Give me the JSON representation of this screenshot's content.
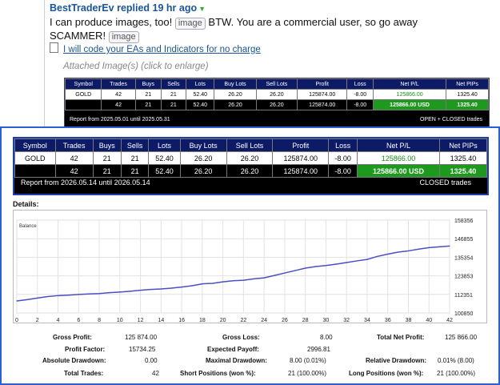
{
  "post": {
    "author": "BestTraderEv",
    "action": " replied ",
    "time": "19 hr ago",
    "line_start": "I can produce images, too!",
    "image_tag": "image",
    "line_end": "BTW. You are a commercial user, so go away",
    "line2": "SCAMMER!",
    "signature": "I will code your EAs and Indicators for no charge",
    "attached": "Attached Image(s) (click to enlarge)"
  },
  "small_report": {
    "headers": [
      "Symbol",
      "Trades",
      "Buys",
      "Sells",
      "Lots",
      "Buy Lots",
      "Sell Lots",
      "Profit",
      "Loss",
      "Net P/L",
      "Net PIPs"
    ],
    "row1": [
      "GOLD",
      "42",
      "21",
      "21",
      "52.40",
      "26.20",
      "26.20",
      "125874.00",
      "-8.00",
      "125866.00",
      "1325.40"
    ],
    "row2": [
      "",
      "42",
      "21",
      "21",
      "52.40",
      "26.20",
      "26.20",
      "125874.00",
      "-8.00",
      "125866.00 USD",
      "1325.40"
    ],
    "footer_left": "Report from 2025.05.01 until 2025.05.31",
    "footer_right": "OPEN + CLOSED trades"
  },
  "big_report": {
    "headers": [
      "Symbol",
      "Trades",
      "Buys",
      "Sells",
      "Lots",
      "Buy Lots",
      "Sell Lots",
      "Profit",
      "Loss",
      "Net P/L",
      "Net PIPs"
    ],
    "row1": [
      "GOLD",
      "42",
      "21",
      "21",
      "52.40",
      "26.20",
      "26.20",
      "125874.00",
      "-8.00",
      "125866.00",
      "1325.40"
    ],
    "row2": [
      "",
      "42",
      "21",
      "21",
      "52.40",
      "26.20",
      "26.20",
      "125874.00",
      "-8.00",
      "125866.00 USD",
      "1325.40"
    ],
    "footer_left": "Report from 2026.05.14 until 2026.05.14",
    "footer_right": "CLOSED trades"
  },
  "details_label": "Details:",
  "chart_data": {
    "type": "line",
    "title": "Balance",
    "x": [
      0,
      1,
      2,
      3,
      4,
      5,
      6,
      7,
      8,
      9,
      10,
      11,
      12,
      13,
      14,
      15,
      16,
      17,
      18,
      19,
      20,
      21,
      22,
      23,
      24,
      25,
      26,
      27,
      28,
      29,
      30,
      31,
      32,
      33,
      34,
      35,
      36,
      37,
      38,
      39,
      40,
      41,
      42
    ],
    "series": [
      {
        "values": [
          108300,
          109100,
          110100,
          111000,
          111600,
          111900,
          112300,
          112600,
          112900,
          113400,
          113800,
          114300,
          114900,
          115400,
          115700,
          116200,
          116900,
          117700,
          118900,
          119200,
          120100,
          120800,
          121100,
          122000,
          122600,
          124100,
          125600,
          127100,
          128600,
          129600,
          130200,
          131100,
          132100,
          133100,
          134000,
          135900,
          137300,
          138500,
          139300,
          140400,
          141300,
          141800,
          142300
        ]
      }
    ],
    "x_ticks": [
      "0",
      "2",
      "4",
      "6",
      "8",
      "10",
      "12",
      "14",
      "16",
      "18",
      "20",
      "22",
      "24",
      "26",
      "28",
      "30",
      "32",
      "34",
      "36",
      "38",
      "40",
      "42"
    ],
    "y_ticks": [
      "100850",
      "112351",
      "123853",
      "135354",
      "146855",
      "158356"
    ],
    "ylim": [
      100850,
      158356
    ],
    "color": "#4a4fc4",
    "grid": true
  },
  "stats": {
    "gross_profit_label": "Gross Profit:",
    "gross_profit": "125 874.00",
    "gross_loss_label": "Gross Loss:",
    "gross_loss": "8.00",
    "total_net_profit_label": "Total Net Profit:",
    "total_net_profit": "125 866.00",
    "profit_factor_label": "Profit Factor:",
    "profit_factor": "15734.25",
    "expected_payoff_label": "Expected Payoff:",
    "expected_payoff": "2996.81",
    "absolute_drawdown_label": "Absolute Drawdown:",
    "absolute_drawdown": "0.00",
    "maximal_drawdown_label": "Maximal Drawdown:",
    "maximal_drawdown": "8.00 (0.01%)",
    "relative_drawdown_label": "Relative Drawdown:",
    "relative_drawdown": "0.01% (8.00)",
    "total_trades_label": "Total Trades:",
    "total_trades": "42",
    "short_positions_label": "Short Positions (won %):",
    "short_positions": "21 (100.00%)",
    "long_positions_label": "Long Positions (won %):",
    "long_positions": "21 (100.00%)"
  }
}
